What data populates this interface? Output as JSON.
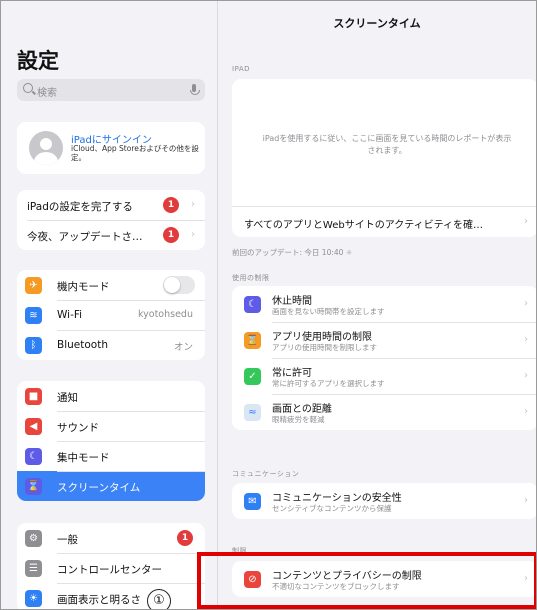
{
  "sidebar": {
    "title": "設定",
    "search_placeholder": "検索",
    "signin": {
      "title": "iPadにサインイン",
      "subtitle": "iCloud、App Storeおよびその他を設定。"
    },
    "group1": [
      {
        "label": "iPadの設定を完了する",
        "badge": "1"
      },
      {
        "label": "今夜、アップデートさ…",
        "badge": "1"
      }
    ],
    "group2": [
      {
        "label": "機内モード",
        "icon": "airplane-icon",
        "color": "#f59a23"
      },
      {
        "label": "Wi-Fi",
        "value": "kyotohsedu",
        "icon": "wifi-icon",
        "color": "#2f7ff5"
      },
      {
        "label": "Bluetooth",
        "value": "オン",
        "icon": "bluetooth-icon",
        "color": "#2f7ff5"
      }
    ],
    "group3": [
      {
        "label": "通知",
        "icon": "notification-icon",
        "color": "#e8453c"
      },
      {
        "label": "サウンド",
        "icon": "sound-icon",
        "color": "#e8453c"
      },
      {
        "label": "集中モード",
        "icon": "moon-icon",
        "color": "#5e5ce6"
      },
      {
        "label": "スクリーンタイム",
        "icon": "hourglass-icon",
        "color": "#5e5ce6"
      }
    ],
    "group4": [
      {
        "label": "一般",
        "badge": "1",
        "icon": "gear-icon",
        "color": "#8e8e93"
      },
      {
        "label": "コントロールセンター",
        "icon": "switches-icon",
        "color": "#8e8e93"
      },
      {
        "label": "画面表示と明るさ",
        "icon": "brightness-icon",
        "color": "#2f7ff5"
      }
    ]
  },
  "main": {
    "title": "スクリーンタイム",
    "section_ipad": "IPAD",
    "report_text": "iPadを使用するに従い、ここに画面を見ている時間のレポートが表示されます。",
    "all_apps": "すべてのアプリとWebサイトのアクティビティを確…",
    "last_update": "前回のアップデート: 今日 10:40",
    "section_limits": "使用の制限",
    "limits": [
      {
        "title": "休止時間",
        "subtitle": "画面を見ない時間帯を設定します",
        "icon": "downtime-icon",
        "color": "#5e5ce6"
      },
      {
        "title": "アプリ使用時間の制限",
        "subtitle": "アプリの使用時間を制限します",
        "icon": "hourglass-icon",
        "color": "#f59a23"
      },
      {
        "title": "常に許可",
        "subtitle": "常に許可するアプリを選択します",
        "icon": "check-icon",
        "color": "#34c759"
      },
      {
        "title": "画面との距離",
        "subtitle": "眼精疲労を軽減",
        "icon": "distance-icon",
        "color": "#dbe6f5"
      }
    ],
    "section_comm": "コミュニケーション",
    "comm": {
      "title": "コミュニケーションの安全性",
      "subtitle": "センシティブなコンテンツから保護",
      "icon": "chat-icon",
      "color": "#2f7ff5"
    },
    "section_restrict": "制限",
    "restrict": {
      "title": "コンテンツとプライバシーの制限",
      "subtitle": "不適切なコンテンツをブロックします",
      "icon": "block-icon",
      "color": "#e8453c"
    }
  },
  "annotation": {
    "number": "①"
  }
}
